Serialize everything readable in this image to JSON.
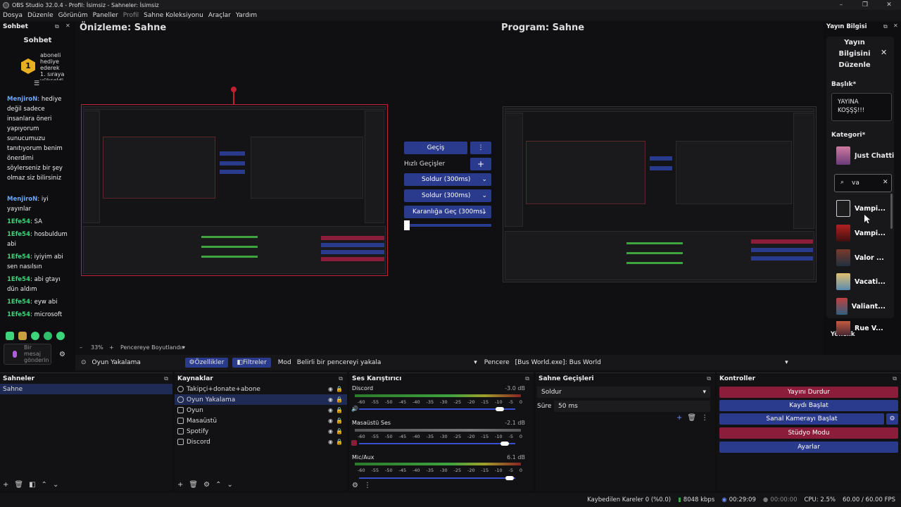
{
  "window": {
    "title": "OBS Studio 32.0.4 - Profil: İsimsiz - Sahneler: İsimsiz"
  },
  "menu": [
    "Dosya",
    "Düzenle",
    "Görünüm",
    "Paneller",
    "Profil",
    "Sahne Koleksiyonu",
    "Araçlar",
    "Yardım"
  ],
  "chat": {
    "dock_title": "Sohbet",
    "header": "Sohbet",
    "gift_text": [
      "aboneli",
      "hediye",
      "ederek",
      "1. sıraya",
      "yükseldi"
    ],
    "messages": [
      {
        "user": "MenjiroN",
        "text": "hediye değil sadece insanlara öneri yapıyorum sunucumuzu tanıtıyorum benim önerdimi söylerseniz bir şey olmaz siz bilirsiniz"
      },
      {
        "user": "MenjiroN",
        "text": "iyi yayınlar"
      },
      {
        "user": "1Efe54",
        "text": "SA"
      },
      {
        "user": "1Efe54",
        "text": "hosbuldum abi"
      },
      {
        "user": "1Efe54",
        "text": "iyiyim abi sen nasılsın"
      },
      {
        "user": "1Efe54",
        "text": "abi gtayı dün aldım"
      },
      {
        "user": "1Efe54",
        "text": "eyw abi"
      },
      {
        "user": "1Efe54",
        "text": "microsoft"
      }
    ],
    "input_placeholder": "Bir mesaj gönderin"
  },
  "preview": {
    "title": "Önizleme: Sahne",
    "zoom": "33%",
    "fit_label": "Pencereye Boyutlandır"
  },
  "program": {
    "title": "Program: Sahne"
  },
  "transitions_mid": {
    "transition_button": "Geçiş",
    "quick_label": "Hızlı Geçişler",
    "items": [
      "Soldur (300ms)",
      "Soldur (300ms)",
      "Karanlığa Geç (300ms)"
    ]
  },
  "stream_info": {
    "dock_title": "Yayın Bilgisi",
    "edit_title": "Yayın Bilgisini Düzenle",
    "title_label": "Başlık*",
    "title_value": "YAYINA KOŞŞŞ!!!",
    "category_label": "Kategori*",
    "category_value": "Just Chattin",
    "search_value": "va",
    "results": [
      "Vampi...",
      "Vampi...",
      "Valor ...",
      "Vacati...",
      "Valiant...",
      "Rue V..."
    ],
    "footer_text": "Yönelik"
  },
  "source_toolbar": {
    "source_name": "Oyun Yakalama",
    "properties": "Özellikler",
    "filters": "Filtreler",
    "mode_label": "Mod",
    "mode_value": "Belirli bir pencereyi yakala",
    "window_label": "Pencere",
    "window_value": "[Bus World.exe]: Bus World"
  },
  "scenes": {
    "title": "Sahneler",
    "items": [
      "Sahne"
    ]
  },
  "sources": {
    "title": "Kaynaklar",
    "items": [
      "Takipçi+donate+abone",
      "Oyun Yakalama",
      "Oyun",
      "Masaüstü",
      "Spotify",
      "Discord"
    ]
  },
  "mixer": {
    "title": "Ses Karıştırıcı",
    "channels": [
      {
        "name": "Discord",
        "db": "-3.0 dB",
        "level": 0.93
      },
      {
        "name": "Masaüstü Ses",
        "db": "-2.1 dB",
        "level": 0.96
      },
      {
        "name": "Mic/Aux",
        "db": "6.1 dB",
        "level": 0.99
      }
    ],
    "ticks": [
      "-60",
      "-55",
      "-50",
      "-45",
      "-40",
      "-35",
      "-30",
      "-25",
      "-20",
      "-15",
      "-10",
      "-5",
      "0"
    ]
  },
  "scene_transitions": {
    "title": "Sahne Geçişleri",
    "type": "Soldur",
    "duration_label": "Süre",
    "duration_value": "50 ms"
  },
  "controls": {
    "title": "Kontroller",
    "buttons": [
      "Yayını Durdur",
      "Kaydı Başlat",
      "Sanal Kamerayı Başlat",
      "Stüdyo Modu",
      "Ayarlar"
    ]
  },
  "status": {
    "dropped": "Kaybedilen Kareler 0 (%0.0)",
    "bitrate": "8048 kbps",
    "stream_time": "00:29:09",
    "rec_time": "00:00:00",
    "cpu": "CPU: 2.5%",
    "fps": "60.00 / 60.00 FPS"
  },
  "colors": {
    "accent_blue": "#2a3a8c",
    "stop_red": "#8b1d3a",
    "live_green": "#3ed47b"
  }
}
